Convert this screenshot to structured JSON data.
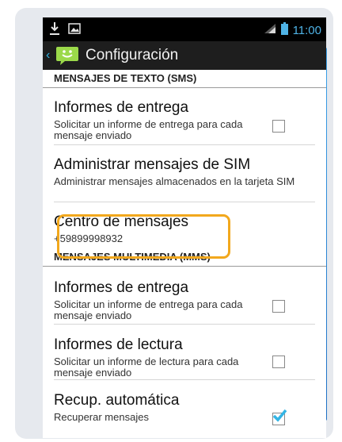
{
  "status_bar": {
    "time": "11:00",
    "icons": [
      "download-icon",
      "image-icon",
      "signal-icon",
      "battery-icon"
    ]
  },
  "action_bar": {
    "back_glyph": "‹",
    "title": "Configuración",
    "app_icon": "messaging-app-icon"
  },
  "sections": [
    {
      "header": "MENSAJES DE TEXTO (SMS)",
      "items": [
        {
          "title": "Informes de entrega",
          "summary": "Solicitar un informe de entrega para cada mensaje enviado",
          "checkbox": true,
          "checked": false
        },
        {
          "title": "Administrar mensajes de SIM",
          "summary": "Administrar mensajes almacenados en la tarjeta SIM",
          "checkbox": false
        },
        {
          "title": "Centro de mensajes",
          "summary": "+59899998932",
          "checkbox": false,
          "highlighted": true
        }
      ]
    },
    {
      "header": "MENSAJES MULTIMEDIA (MMS)",
      "items": [
        {
          "title": "Informes de entrega",
          "summary": "Solicitar un informe de entrega para cada mensaje enviado",
          "checkbox": true,
          "checked": false
        },
        {
          "title": "Informes de lectura",
          "summary": "Solicitar un informe de lectura para cada mensaje enviado",
          "checkbox": true,
          "checked": false
        },
        {
          "title": "Recup. automática",
          "summary": "Recuperar mensajes",
          "checkbox": true,
          "checked": true
        }
      ]
    }
  ],
  "colors": {
    "accent": "#33b5e5",
    "highlight": "#f2a81d",
    "clock": "#4fb3e6",
    "app_icon": "#9bd94a"
  }
}
